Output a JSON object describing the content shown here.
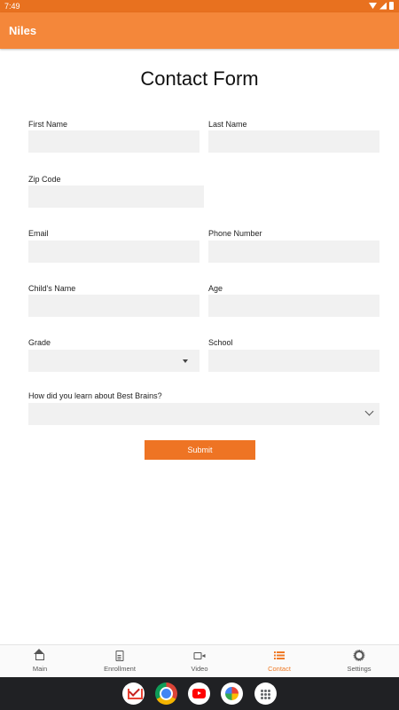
{
  "status_bar": {
    "time": "7:49"
  },
  "app_bar": {
    "title": "Niles"
  },
  "form": {
    "title": "Contact Form",
    "first_name": {
      "label": "First Name",
      "value": ""
    },
    "last_name": {
      "label": "Last Name",
      "value": ""
    },
    "zip_code": {
      "label": "Zip Code",
      "value": ""
    },
    "email": {
      "label": "Email",
      "value": ""
    },
    "phone_number": {
      "label": "Phone Number",
      "value": ""
    },
    "childs_name": {
      "label": "Child's Name",
      "value": ""
    },
    "age": {
      "label": "Age",
      "value": ""
    },
    "grade": {
      "label": "Grade",
      "selected": ""
    },
    "school": {
      "label": "School",
      "value": ""
    },
    "referral": {
      "label": "How did you learn about Best Brains?",
      "selected": ""
    },
    "submit_label": "Submit"
  },
  "bottom_nav": {
    "items": [
      {
        "label": "Main",
        "icon": "home-icon"
      },
      {
        "label": "Enrollment",
        "icon": "document-icon"
      },
      {
        "label": "Video",
        "icon": "video-icon"
      },
      {
        "label": "Contact",
        "icon": "list-icon",
        "active": true
      },
      {
        "label": "Settings",
        "icon": "gear-icon"
      }
    ]
  },
  "dock": {
    "apps": [
      "gmail-icon",
      "chrome-icon",
      "youtube-icon",
      "photos-icon",
      "apps-icon"
    ]
  },
  "colors": {
    "status_bar": "#e8711f",
    "app_bar": "#f4873a",
    "accent": "#ee7424",
    "field_background": "#f1f1f1",
    "dock": "#202124"
  }
}
